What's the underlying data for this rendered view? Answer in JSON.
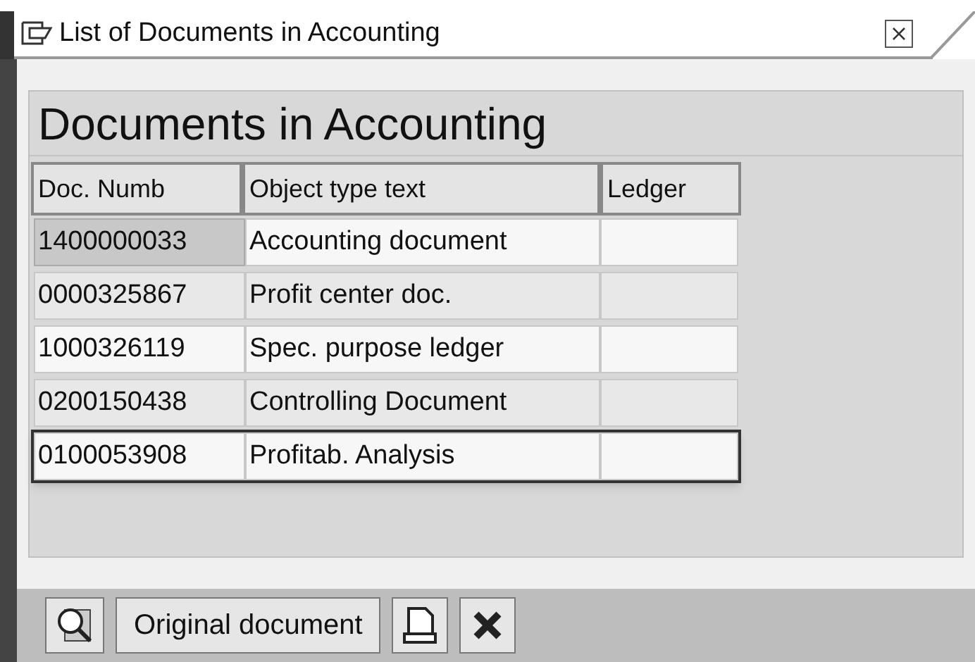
{
  "window": {
    "title": "List of Documents in Accounting"
  },
  "heading": "Documents in Accounting",
  "table": {
    "columns": [
      "Doc. Numb",
      "Object type text",
      "Ledger"
    ],
    "rows": [
      {
        "doc_number": "1400000033",
        "object_type_text": "Accounting document",
        "selected": true,
        "focused": false
      },
      {
        "doc_number": "0000325867",
        "object_type_text": "Profit center doc.",
        "selected": false,
        "focused": false
      },
      {
        "doc_number": "1000326119",
        "object_type_text": "Spec. purpose ledger",
        "selected": false,
        "focused": false
      },
      {
        "doc_number": "0200150438",
        "object_type_text": "Controlling Document",
        "selected": false,
        "focused": false
      },
      {
        "doc_number": "0100053908",
        "object_type_text": "Profitab. Analysis",
        "selected": false,
        "focused": true
      }
    ]
  },
  "toolbar": {
    "button_label": "Original document"
  }
}
